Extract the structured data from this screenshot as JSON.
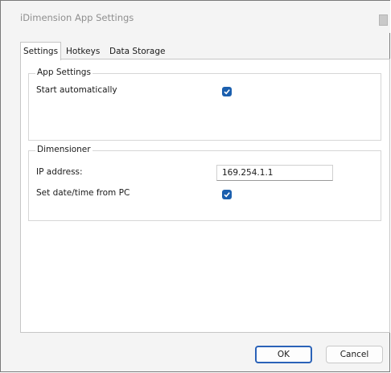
{
  "window": {
    "title": "iDimension App Settings"
  },
  "tabs": [
    {
      "label": "Settings",
      "active": true
    },
    {
      "label": "Hotkeys",
      "active": false
    },
    {
      "label": "Data Storage",
      "active": false
    }
  ],
  "app_settings": {
    "group_title": "App Settings",
    "start_auto_label": "Start automatically",
    "start_auto_checked": true
  },
  "dimensioner": {
    "group_title": "Dimensioner",
    "ip_label": "IP address:",
    "ip_value": "169.254.1.1",
    "set_date_label": "Set date/time from PC",
    "set_date_checked": true
  },
  "footer": {
    "ok_label": "OK",
    "cancel_label": "Cancel"
  },
  "colors": {
    "checkbox": "#1b5fae",
    "default_button_border": "#2a62b8"
  }
}
